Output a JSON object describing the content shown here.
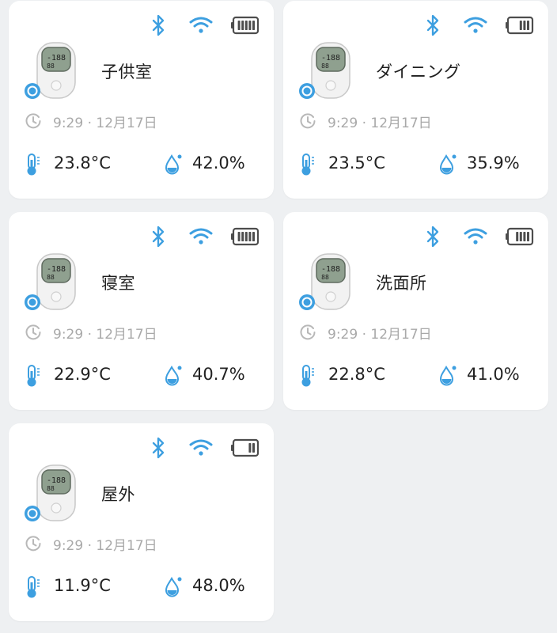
{
  "time_text": "9:29 · 12月17日",
  "accent_color": "#3d9fe0",
  "cards": [
    {
      "name": "子供室",
      "temperature": "23.8°C",
      "humidity": "42.0%",
      "battery_bars": 5,
      "battery_level": "full"
    },
    {
      "name": "ダイニング",
      "temperature": "23.5°C",
      "humidity": "35.9%",
      "battery_bars": 3,
      "battery_level": "medium"
    },
    {
      "name": "寝室",
      "temperature": "22.9°C",
      "humidity": "40.7%",
      "battery_bars": 5,
      "battery_level": "full"
    },
    {
      "name": "洗面所",
      "temperature": "22.8°C",
      "humidity": "41.0%",
      "battery_bars": 4,
      "battery_level": "high"
    },
    {
      "name": "屋外",
      "temperature": "11.9°C",
      "humidity": "48.0%",
      "battery_bars": 2,
      "battery_level": "low"
    }
  ],
  "icons": {
    "status": [
      "bluetooth-icon",
      "wifi-icon",
      "battery-icon"
    ],
    "device": "thermometer-device-image",
    "clock": "clock-icon",
    "temperature": "thermometer-icon",
    "humidity": "humidity-drop-icon"
  }
}
